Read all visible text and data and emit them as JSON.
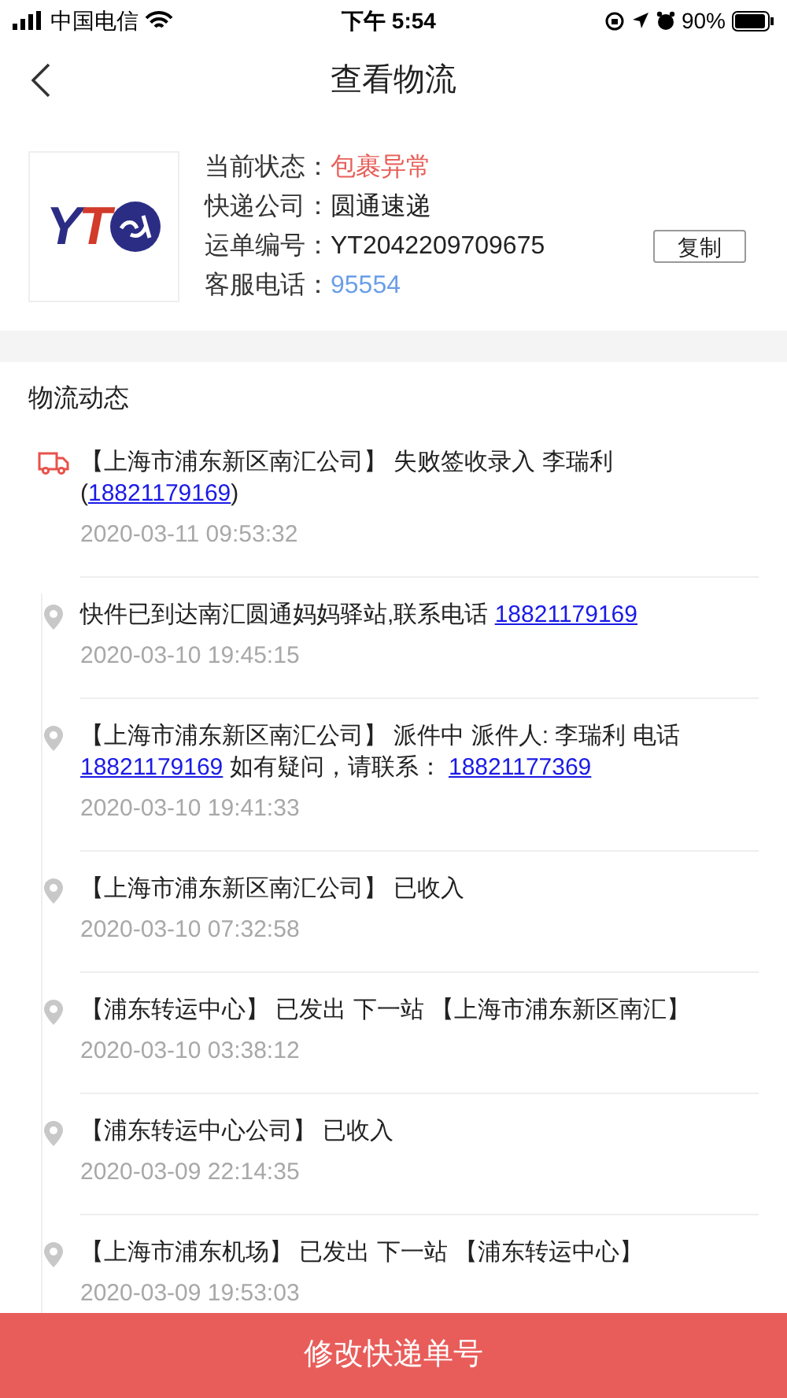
{
  "status_bar": {
    "carrier": "中国电信",
    "time": "下午 5:54",
    "battery": "90%"
  },
  "header": {
    "title": "查看物流"
  },
  "logo": {
    "letters": [
      "Y",
      "T"
    ]
  },
  "info": [
    {
      "label": "当前状态：",
      "value": "包裹异常",
      "kind": "alert"
    },
    {
      "label": "快递公司：",
      "value": "圆通速递",
      "kind": "plain"
    },
    {
      "label": "运单编号：",
      "value": "YT2042209709675",
      "kind": "copy",
      "button": "复制"
    },
    {
      "label": "客服电话：",
      "value": "95554",
      "kind": "phone"
    }
  ],
  "section_title": "物流动态",
  "events": [
    {
      "kind": "truck",
      "segments": [
        {
          "kind": "text",
          "text": "【上海市浦东新区南汇公司】 失败签收录入 李瑞利 ("
        },
        {
          "kind": "link",
          "text": "18821179169"
        },
        {
          "kind": "text",
          "text": ")"
        }
      ],
      "time": "2020-03-11 09:53:32"
    },
    {
      "kind": "pin",
      "segments": [
        {
          "kind": "text",
          "text": "快件已到达南汇圆通妈妈驿站,联系电话 "
        },
        {
          "kind": "link",
          "text": "18821179169"
        }
      ],
      "time": "2020-03-10 19:45:15"
    },
    {
      "kind": "pin",
      "segments": [
        {
          "kind": "text",
          "text": "【上海市浦东新区南汇公司】 派件中 派件人: 李瑞利 电话 "
        },
        {
          "kind": "link",
          "text": "18821179169"
        },
        {
          "kind": "text",
          "text": " 如有疑问，请联系： "
        },
        {
          "kind": "link",
          "text": "18821177369"
        }
      ],
      "time": "2020-03-10 19:41:33"
    },
    {
      "kind": "pin",
      "segments": [
        {
          "kind": "text",
          "text": "【上海市浦东新区南汇公司】 已收入"
        }
      ],
      "time": "2020-03-10 07:32:58"
    },
    {
      "kind": "pin",
      "segments": [
        {
          "kind": "text",
          "text": "【浦东转运中心】 已发出 下一站 【上海市浦东新区南汇】"
        }
      ],
      "time": "2020-03-10 03:38:12"
    },
    {
      "kind": "pin",
      "segments": [
        {
          "kind": "text",
          "text": "【浦东转运中心公司】 已收入"
        }
      ],
      "time": "2020-03-09 22:14:35"
    },
    {
      "kind": "pin",
      "segments": [
        {
          "kind": "text",
          "text": "【上海市浦东机场】 已发出 下一站 【浦东转运中心】"
        }
      ],
      "time": "2020-03-09 19:53:03"
    }
  ],
  "bottom_button": "修改快递单号"
}
